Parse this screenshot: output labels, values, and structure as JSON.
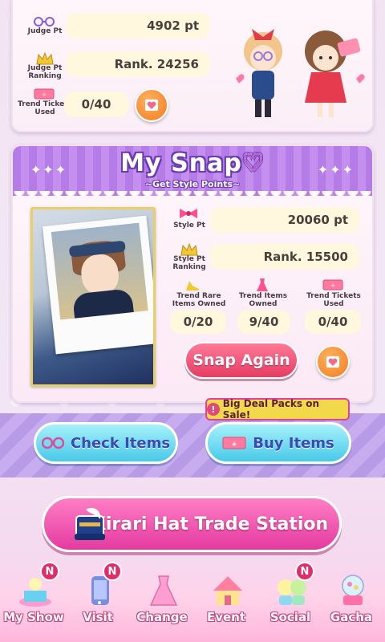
{
  "judge": {
    "judge_pt_label": "Judge Pt",
    "judge_pt_value": "4902 pt",
    "ranking_label": "Judge Pt\nRanking",
    "ranking_value": "Rank. 24256",
    "tickets_label": "Trend Tickets\nUsed",
    "tickets_value": "0/40"
  },
  "snap": {
    "title": "My Snap",
    "subtitle": "~Get Style Points~",
    "style_pt_label": "Style Pt",
    "style_pt_value": "20060 pt",
    "style_rank_label": "Style Pt\nRanking",
    "style_rank_value": "Rank. 15500",
    "rare_label": "Trend Rare\nItems Owned",
    "rare_value": "0/20",
    "items_label": "Trend Items\nOwned",
    "items_value": "9/40",
    "tickets_label": "Trend Tickets\nUsed",
    "tickets_value": "0/40",
    "snap_again": "Snap Again"
  },
  "promo": {
    "big_deal": "Big Deal Packs on Sale!",
    "check_items": "Check Items",
    "buy_items": "Buy Items",
    "trade_station": "Kirari Hat Trade Station"
  },
  "nav": {
    "items": [
      {
        "label": "My Show",
        "badge": "N"
      },
      {
        "label": "Visit",
        "badge": "N"
      },
      {
        "label": "Change",
        "badge": ""
      },
      {
        "label": "Event",
        "badge": ""
      },
      {
        "label": "Social",
        "badge": "N"
      },
      {
        "label": "Gacha",
        "badge": ""
      }
    ]
  },
  "colors": {
    "pink_accent": "#e43aa0",
    "purple_header": "#b57be6",
    "blue_button": "#48c9e9",
    "orange_button": "#f37b21"
  },
  "icons": [
    "glasses-icon",
    "crown-icon",
    "ticket-icon",
    "heart-icon",
    "bow-icon",
    "dress-icon",
    "hat-icon"
  ]
}
